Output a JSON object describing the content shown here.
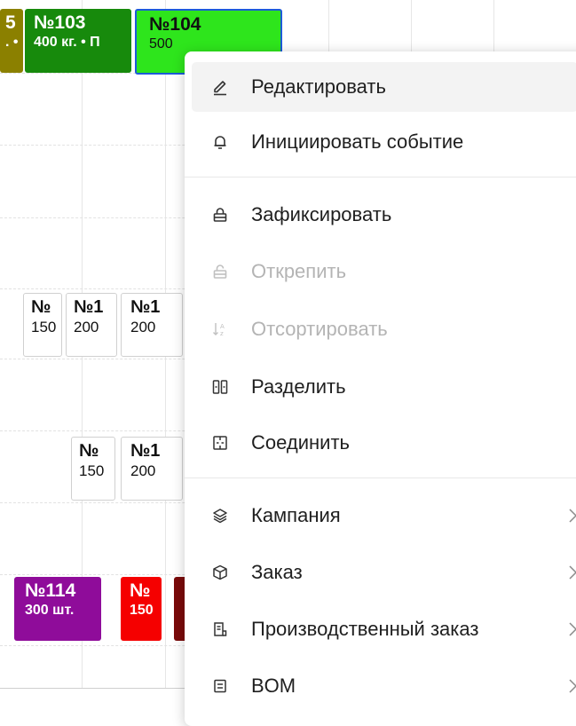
{
  "colors": {
    "olive": "#8b8000",
    "green_dark": "#178a0c",
    "green_bright": "#2ee51c",
    "purple": "#8f0c9a",
    "red": "#f50000",
    "maroon": "#7a0a0a",
    "disabled_text": "#b4b4b4"
  },
  "gantt": {
    "bars": [
      {
        "id": "b1",
        "num": "5",
        "qty": ". •"
      },
      {
        "id": "b2",
        "num": "№103",
        "qty": "400 кг. • П"
      },
      {
        "id": "b3",
        "num": "№104",
        "qty": "500"
      },
      {
        "id": "b4",
        "num": "№",
        "qty": "150"
      },
      {
        "id": "b5",
        "num": "№1",
        "qty": "200"
      },
      {
        "id": "b6",
        "num": "№1",
        "qty": "200"
      },
      {
        "id": "b7",
        "num": "№",
        "qty": "150"
      },
      {
        "id": "b8",
        "num": "№1",
        "qty": "200"
      },
      {
        "id": "b9",
        "num": "№114",
        "qty": "300 шт."
      },
      {
        "id": "b10",
        "num": "№",
        "qty": "150"
      }
    ]
  },
  "menu": {
    "items": [
      {
        "label": "Редактировать",
        "icon": "pencil-icon",
        "disabled": false,
        "hover": true
      },
      {
        "label": "Инициировать событие",
        "icon": "bell-icon",
        "disabled": false
      },
      {
        "label": "Зафиксировать",
        "icon": "lock-icon",
        "disabled": false
      },
      {
        "label": "Открепить",
        "icon": "unlock-icon",
        "disabled": true
      },
      {
        "label": "Отсортировать",
        "icon": "sort-icon",
        "disabled": true
      },
      {
        "label": "Разделить",
        "icon": "split-icon",
        "disabled": false
      },
      {
        "label": "Соединить",
        "icon": "merge-icon",
        "disabled": false
      },
      {
        "label": "Кампания",
        "icon": "layers-icon",
        "disabled": false,
        "submenu": true
      },
      {
        "label": "Заказ",
        "icon": "box-icon",
        "disabled": false,
        "submenu": true
      },
      {
        "label": "Производственный заказ",
        "icon": "document-icon",
        "disabled": false,
        "submenu": true
      },
      {
        "label": "BOM",
        "icon": "bom-icon",
        "disabled": false,
        "submenu": true
      }
    ]
  }
}
